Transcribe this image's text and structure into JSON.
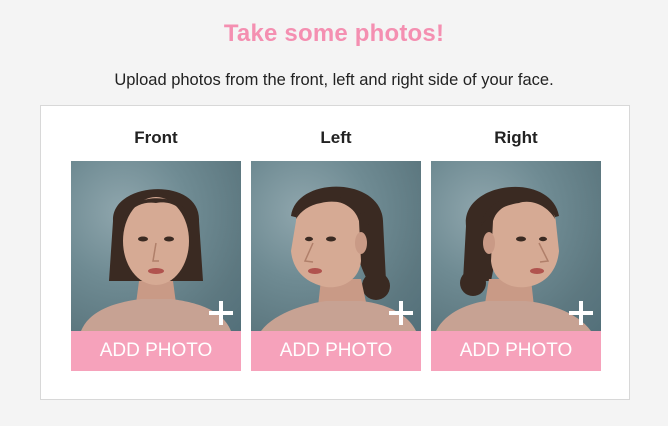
{
  "header": {
    "title": "Take some photos!",
    "subtitle": "Upload photos from the front, left and right side of your face."
  },
  "slots": [
    {
      "label": "Front",
      "button_label": "ADD PHOTO",
      "icon": "plus-icon"
    },
    {
      "label": "Left",
      "button_label": "ADD PHOTO",
      "icon": "plus-icon"
    },
    {
      "label": "Right",
      "button_label": "ADD PHOTO",
      "icon": "plus-icon"
    }
  ],
  "colors": {
    "accent": "#f48fb1",
    "button": "#f6a2bb",
    "photo_background": "#6f8b93"
  }
}
